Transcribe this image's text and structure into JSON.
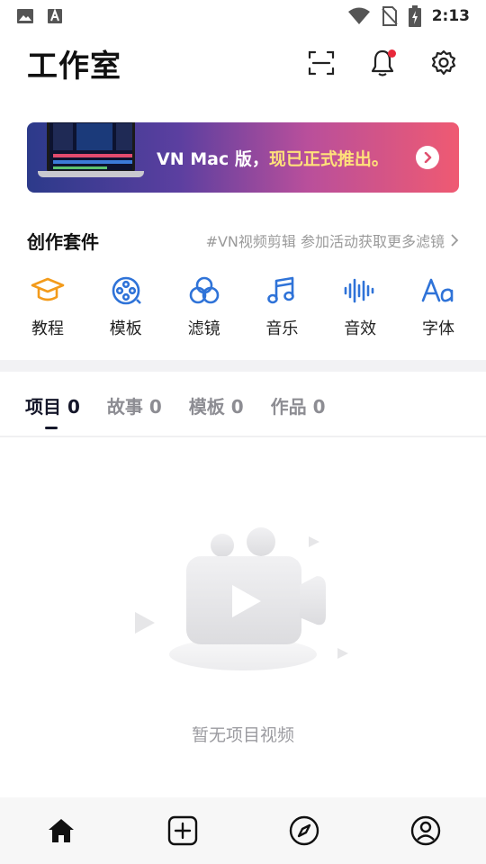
{
  "status_bar": {
    "time": "2:13",
    "left_icons": [
      "image-icon",
      "app-a-icon"
    ],
    "right_icons": [
      "wifi-icon",
      "no-sim-icon",
      "battery-charging-icon"
    ]
  },
  "header": {
    "title": "工作室",
    "actions": [
      "scan-icon",
      "bell-icon",
      "gear-icon"
    ]
  },
  "banner": {
    "text_main": "VN Mac 版，",
    "text_highlight": "现已正式推出。"
  },
  "kit": {
    "title": "创作套件",
    "link": "#VN视频剪辑 参加活动获取更多滤镜",
    "items": [
      {
        "label": "教程",
        "icon": "graduation-cap-icon",
        "color": "#f39b1b"
      },
      {
        "label": "模板",
        "icon": "film-reel-icon",
        "color": "#2f73d8"
      },
      {
        "label": "滤镜",
        "icon": "filter-circles-icon",
        "color": "#2f73d8"
      },
      {
        "label": "音乐",
        "icon": "music-note-icon",
        "color": "#2f73d8"
      },
      {
        "label": "音效",
        "icon": "sound-wave-icon",
        "color": "#2f73d8"
      },
      {
        "label": "字体",
        "icon": "font-aa-icon",
        "color": "#2f73d8"
      }
    ]
  },
  "tabs": [
    {
      "label": "项目 0",
      "active": true
    },
    {
      "label": "故事 0",
      "active": false
    },
    {
      "label": "模板 0",
      "active": false
    },
    {
      "label": "作品 0",
      "active": false
    }
  ],
  "empty_state": {
    "text": "暂无项目视频",
    "icon": "video-camera-icon"
  },
  "bottom_nav": [
    {
      "icon": "home-icon"
    },
    {
      "icon": "add-square-icon"
    },
    {
      "icon": "compass-icon"
    },
    {
      "icon": "profile-icon"
    }
  ],
  "colors": {
    "accent_blue": "#2f73d8",
    "accent_orange": "#f39b1b",
    "notification_red": "#e8283a",
    "banner_highlight": "#ffe17a"
  }
}
